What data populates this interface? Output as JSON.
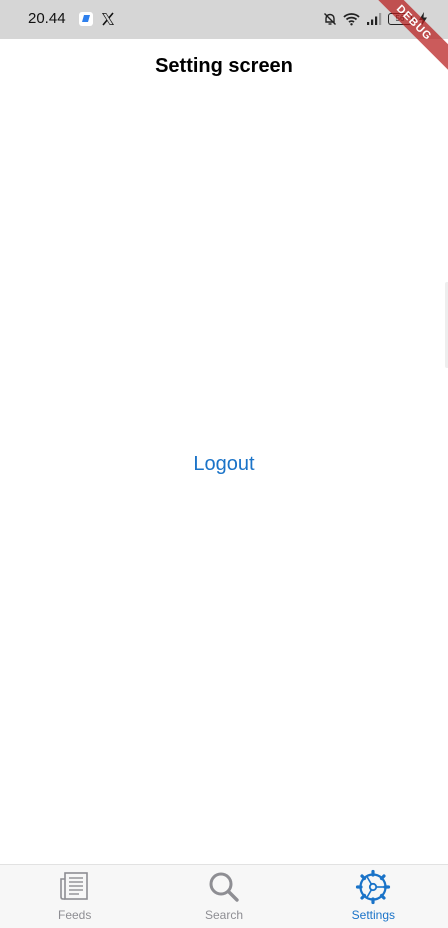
{
  "status_bar": {
    "time": "20.44",
    "battery_level": "56",
    "icons": [
      "app-notification-icon",
      "x-icon",
      "bell-off-icon",
      "wifi-icon",
      "signal-icon",
      "battery-icon",
      "charging-icon"
    ]
  },
  "debug_banner": "DEBUG",
  "app_bar": {
    "title": "Setting screen"
  },
  "body": {
    "logout_label": "Logout"
  },
  "bottom_nav": {
    "active_index": 2,
    "items": [
      {
        "label": "Feeds",
        "icon": "newspaper-icon"
      },
      {
        "label": "Search",
        "icon": "search-icon"
      },
      {
        "label": "Settings",
        "icon": "settings-gear-icon"
      }
    ]
  },
  "colors": {
    "accent": "#1a73c8",
    "inactive": "#8e8e93",
    "status_bar_bg": "#d6d6d6",
    "nav_bg": "#f7f7f7",
    "debug_ribbon": "#b71c1c"
  }
}
